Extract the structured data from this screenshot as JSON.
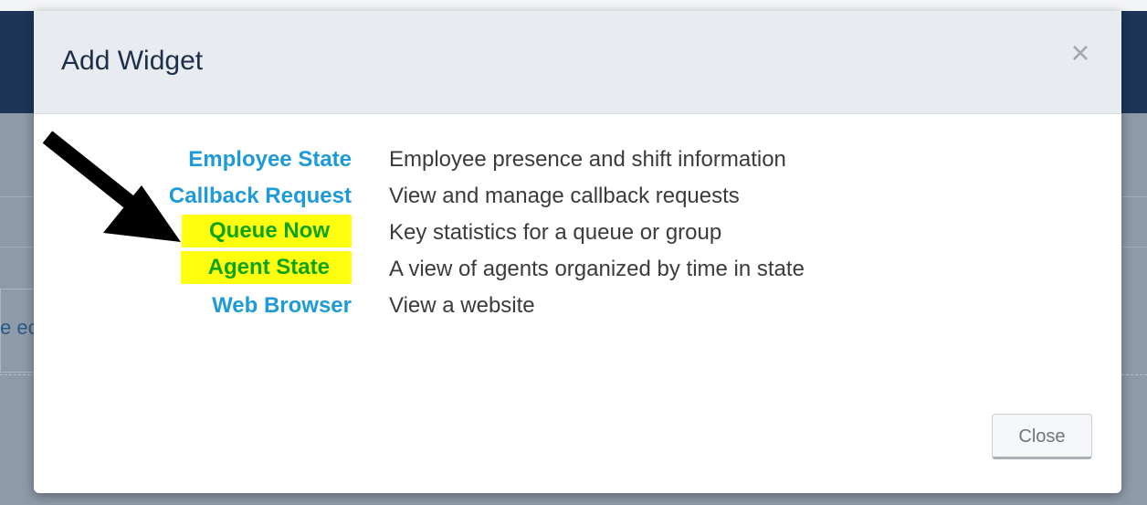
{
  "background": {
    "partial_text": "e ec"
  },
  "modal": {
    "title": "Add Widget",
    "close_x": "×",
    "widgets": [
      {
        "name": "Employee State",
        "description": "Employee presence and shift information",
        "highlighted": false
      },
      {
        "name": "Callback Request",
        "description": "View and manage callback requests",
        "highlighted": false
      },
      {
        "name": "Queue Now",
        "description": "Key statistics for a queue or group",
        "highlighted": true
      },
      {
        "name": "Agent State",
        "description": "A view of agents organized by time in state",
        "highlighted": true
      },
      {
        "name": "Web Browser",
        "description": "View a website",
        "highlighted": false
      }
    ],
    "close_button_label": "Close"
  },
  "colors": {
    "link": "#1e9ad6",
    "highlight_bg": "#ffff0f",
    "highlight_text": "#0fa316",
    "navbar": "#1d3557"
  },
  "annotation": {
    "icon": "arrow-icon"
  }
}
